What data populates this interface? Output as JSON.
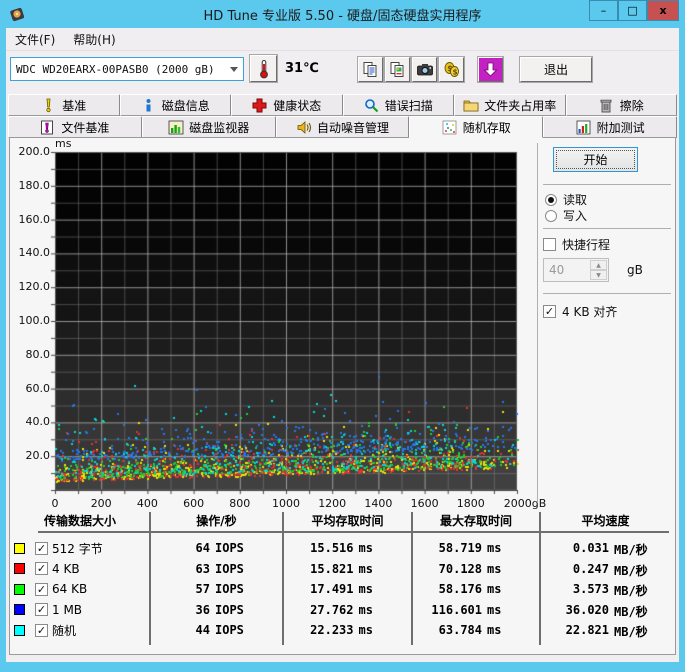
{
  "window": {
    "title": "HD Tune 专业版 5.50 - 硬盘/固态硬盘实用程序",
    "controls": {
      "minimize": "–",
      "maximize": "□",
      "close": "x"
    }
  },
  "menu": {
    "items": [
      {
        "name": "file",
        "label": "文件(F)"
      },
      {
        "name": "help",
        "label": "帮助(H)"
      }
    ]
  },
  "toolbar": {
    "drive_select": {
      "value": "WDC WD20EARX-00PASB0  (2000 gB)"
    },
    "temperature": "31℃",
    "buttons": [
      {
        "name": "copy-text",
        "icon": "copy-text-icon"
      },
      {
        "name": "copy-image",
        "icon": "copy-image-icon"
      },
      {
        "name": "screenshot",
        "icon": "camera-icon"
      },
      {
        "name": "donate",
        "icon": "coins-icon"
      },
      {
        "name": "update",
        "icon": "download-arrow-icon"
      }
    ],
    "exit_label": "退出"
  },
  "tabs": {
    "row1": [
      {
        "name": "benchmark",
        "label": "基准",
        "icon": "exclamation-icon"
      },
      {
        "name": "disk-info",
        "label": "磁盘信息",
        "icon": "info-icon"
      },
      {
        "name": "health",
        "label": "健康状态",
        "icon": "health-cross-icon"
      },
      {
        "name": "error-scan",
        "label": "错误扫描",
        "icon": "magnifier-icon"
      },
      {
        "name": "folder-usage",
        "label": "文件夹占用率",
        "icon": "folder-icon"
      },
      {
        "name": "erase",
        "label": "擦除",
        "icon": "trash-icon"
      }
    ],
    "row2": [
      {
        "name": "file-benchmark",
        "label": "文件基准",
        "icon": "file-exclamation-icon"
      },
      {
        "name": "disk-monitor",
        "label": "磁盘监视器",
        "icon": "bar-chart-icon"
      },
      {
        "name": "aam",
        "label": "自动噪音管理",
        "icon": "speaker-icon"
      },
      {
        "name": "random-access",
        "label": "随机存取",
        "icon": "scatter-icon",
        "active": true
      },
      {
        "name": "extra-tests",
        "label": "附加测试",
        "icon": "extra-tests-icon"
      }
    ]
  },
  "controls": {
    "start_label": "开始",
    "read_label": "读取",
    "write_label": "写入",
    "read_selected": true,
    "short_stroke_label": "快捷行程",
    "short_stroke_checked": false,
    "short_stroke_value": "40",
    "short_stroke_unit": "gB",
    "align_label": "4 KB 对齐",
    "align_checked": true
  },
  "chart_data": {
    "type": "scatter",
    "y_unit": "ms",
    "x_unit": "gB",
    "xlim": [
      0,
      2000
    ],
    "ylim": [
      0,
      200
    ],
    "x_ticks": [
      "0",
      "200",
      "400",
      "600",
      "800",
      "1000",
      "1200",
      "1400",
      "1600",
      "1800",
      "2000gB"
    ],
    "y_ticks": [
      "200.0",
      "180.0",
      "160.0",
      "140.0",
      "120.0",
      "100.0",
      "80.0",
      "60.0",
      "40.0",
      "20.0"
    ],
    "grid": {
      "x_major": 200,
      "x_minor": 100,
      "y_major": 20,
      "y_minor": 10
    },
    "floor_ms": {
      "at_0": 4.5,
      "at_2000": 12
    },
    "seed": 1337,
    "series": [
      {
        "name": "512 字节",
        "swatch": "#ffff00",
        "point_color": "#f2e000",
        "count": 520,
        "offset": 0.8,
        "spread": 6.0,
        "avg_ms": 15.516,
        "max_ms": 58.719
      },
      {
        "name": "4 KB",
        "swatch": "#ff0000",
        "point_color": "#e83030",
        "count": 520,
        "offset": 0.8,
        "spread": 6.5,
        "avg_ms": 15.821,
        "max_ms": 70.128
      },
      {
        "name": "64 KB",
        "swatch": "#00ff00",
        "point_color": "#22cc33",
        "count": 500,
        "offset": 2.0,
        "spread": 7.0,
        "avg_ms": 17.491,
        "max_ms": 58.176
      },
      {
        "name": "1 MB",
        "swatch": "#0000ff",
        "point_color": "#2277ee",
        "count": 430,
        "offset": 13.0,
        "spread": 6.0,
        "avg_ms": 27.762,
        "max_ms": 116.601
      },
      {
        "name": "随机",
        "swatch": "#00ffff",
        "point_color": "#00d8d8",
        "count": 320,
        "offset": 2.5,
        "spread": 10.5,
        "avg_ms": 22.233,
        "max_ms": 63.784
      }
    ]
  },
  "table": {
    "headers": [
      "传输数据大小",
      "操作/秒",
      "平均存取时间",
      "最大存取时间",
      "平均速度"
    ],
    "rows": [
      {
        "color": "#ffff00",
        "checked": true,
        "label": "512 字节",
        "iops": "64",
        "iops_unit": "IOPS",
        "avg": "15.516",
        "avg_unit": "ms",
        "max": "58.719",
        "max_unit": "ms",
        "speed": "0.031",
        "speed_unit": "MB/秒"
      },
      {
        "color": "#ff0000",
        "checked": true,
        "label": "4 KB",
        "iops": "63",
        "iops_unit": "IOPS",
        "avg": "15.821",
        "avg_unit": "ms",
        "max": "70.128",
        "max_unit": "ms",
        "speed": "0.247",
        "speed_unit": "MB/秒"
      },
      {
        "color": "#00ff00",
        "checked": true,
        "label": "64 KB",
        "iops": "57",
        "iops_unit": "IOPS",
        "avg": "17.491",
        "avg_unit": "ms",
        "max": "58.176",
        "max_unit": "ms",
        "speed": "3.573",
        "speed_unit": "MB/秒"
      },
      {
        "color": "#0000ff",
        "checked": true,
        "label": "1 MB",
        "iops": "36",
        "iops_unit": "IOPS",
        "avg": "27.762",
        "avg_unit": "ms",
        "max": "116.601",
        "max_unit": "ms",
        "speed": "36.020",
        "speed_unit": "MB/秒"
      },
      {
        "color": "#00ffff",
        "checked": true,
        "label": "随机",
        "iops": "44",
        "iops_unit": "IOPS",
        "avg": "22.233",
        "avg_unit": "ms",
        "max": "63.784",
        "max_unit": "ms",
        "speed": "22.821",
        "speed_unit": "MB/秒"
      }
    ]
  }
}
